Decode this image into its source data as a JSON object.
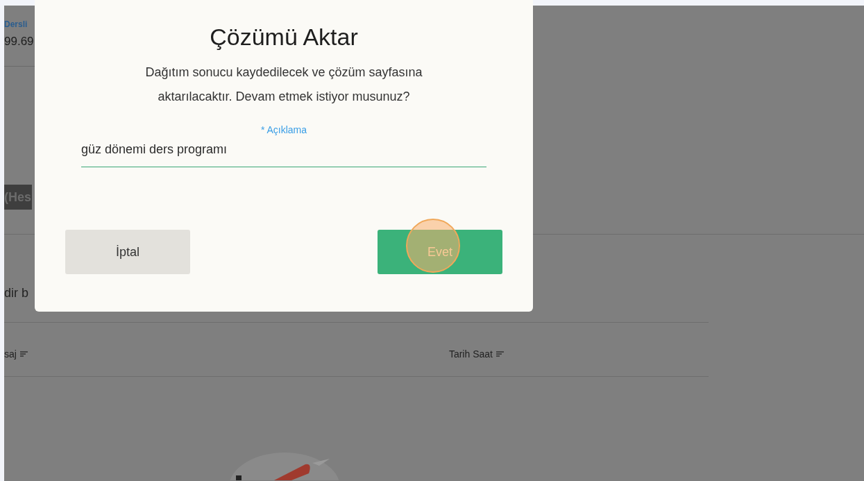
{
  "background": {
    "link_text": "Dersli",
    "value_text": "99.69",
    "section_label": "(Hes",
    "body_text": "dir b",
    "table": {
      "columns": [
        {
          "label": "saj",
          "sortable": true
        },
        {
          "label": "Tarih Saat",
          "sortable": true
        }
      ]
    }
  },
  "dialog": {
    "title": "Çözümü Aktar",
    "message": "Dağıtım sonucu kaydedilecek ve çözüm sayfasına aktarılacaktır. Devam etmek istiyor musunuz?",
    "field": {
      "label": "* Açıklama",
      "value": "güz dönemi ders programı"
    },
    "buttons": [
      {
        "label": "İptal",
        "kind": "secondary"
      },
      {
        "label": "Evet",
        "kind": "primary"
      }
    ]
  }
}
